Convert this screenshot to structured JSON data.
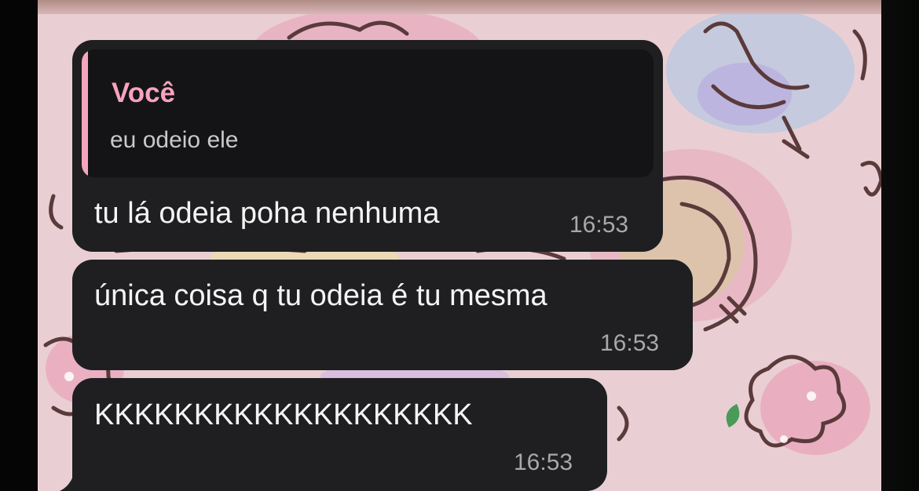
{
  "colors": {
    "bubble_bg": "#1f1f21",
    "quote_bg": "#141416",
    "quote_accent": "#f5a6bd",
    "wallpaper": "#e9cfd3",
    "time_text": "#a8a8aa"
  },
  "messages": [
    {
      "reply": {
        "author": "Você",
        "text": "eu odeio ele"
      },
      "text": "tu lá odeia poha nenhuma",
      "time": "16:53"
    },
    {
      "text": "única coisa q tu odeia é tu mesma",
      "time": "16:53"
    },
    {
      "text": "KKKKKKKKKKKKKKKKKKK",
      "time": "16:53"
    }
  ]
}
